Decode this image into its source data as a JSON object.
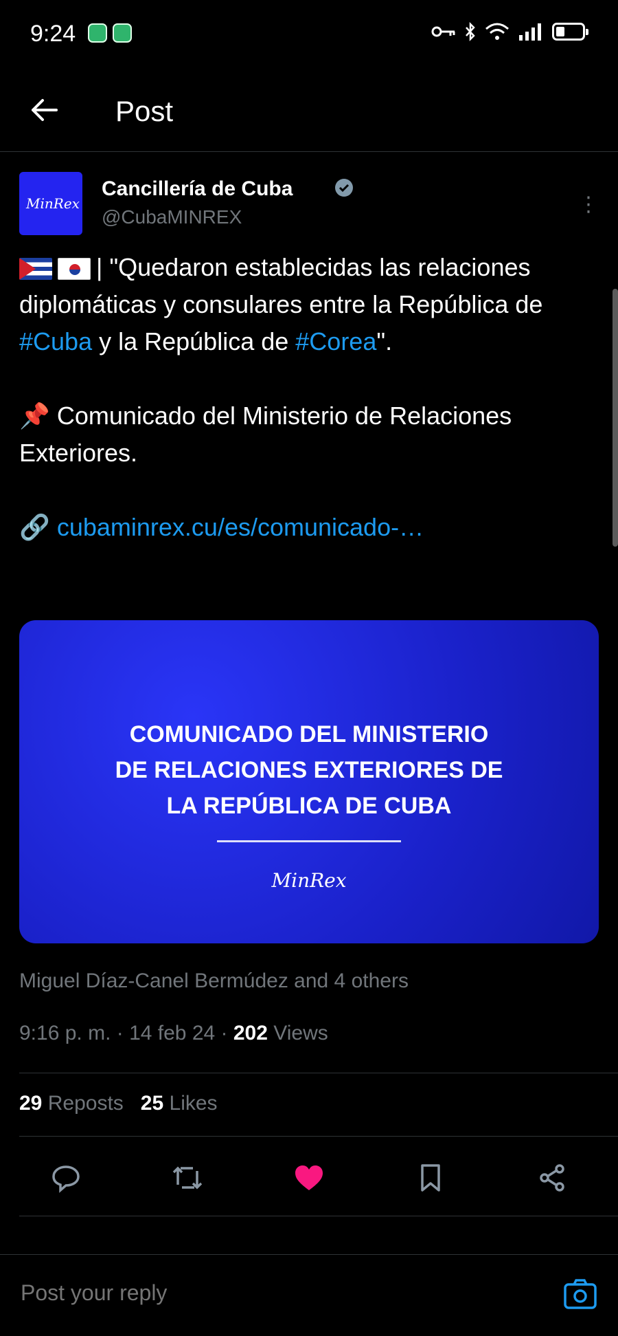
{
  "status_bar": {
    "time": "9:24",
    "icons": [
      "notification-app-icon",
      "notification-app-icon",
      "key-icon",
      "bluetooth-icon",
      "wifi-icon",
      "signal-icon",
      "battery-icon"
    ]
  },
  "header": {
    "title": "Post"
  },
  "post": {
    "author_name": "Cancillería de Cuba",
    "handle": "@CubaMINREX",
    "avatar_text": "MinRex",
    "text_line1_a": "| \"Quedaron establecidas las relaciones diplomáticas y consulares entre la República de ",
    "hashtag_cuba": "#Cuba",
    "text_line1_b": " y la República de ",
    "hashtag_corea": "#Corea",
    "text_line1_c": "\".",
    "pin_text": " Comunicado del Ministerio de Relaciones Exteriores.",
    "link": "cubaminrex.cu/es/comunicado-…",
    "card": {
      "line1": "COMUNICADO DEL MINISTERIO",
      "line2": "DE RELACIONES EXTERIORES DE",
      "line3": "LA REPÚBLICA DE CUBA",
      "logo": "MinRex"
    },
    "liked_by": "Miguel Díaz-Canel Bermúdez and 4 others",
    "time": "9:16 p. m.",
    "date": "14 feb 24",
    "views_count": "202",
    "views_label": "Views",
    "reposts_count": "29",
    "reposts_label": "Reposts",
    "likes_count": "25",
    "likes_label": "Likes"
  },
  "reply": {
    "placeholder": "Post your reply"
  },
  "colors": {
    "accent": "#1d9bf0",
    "like": "#f91880",
    "card_bg": "#1a21c9"
  }
}
